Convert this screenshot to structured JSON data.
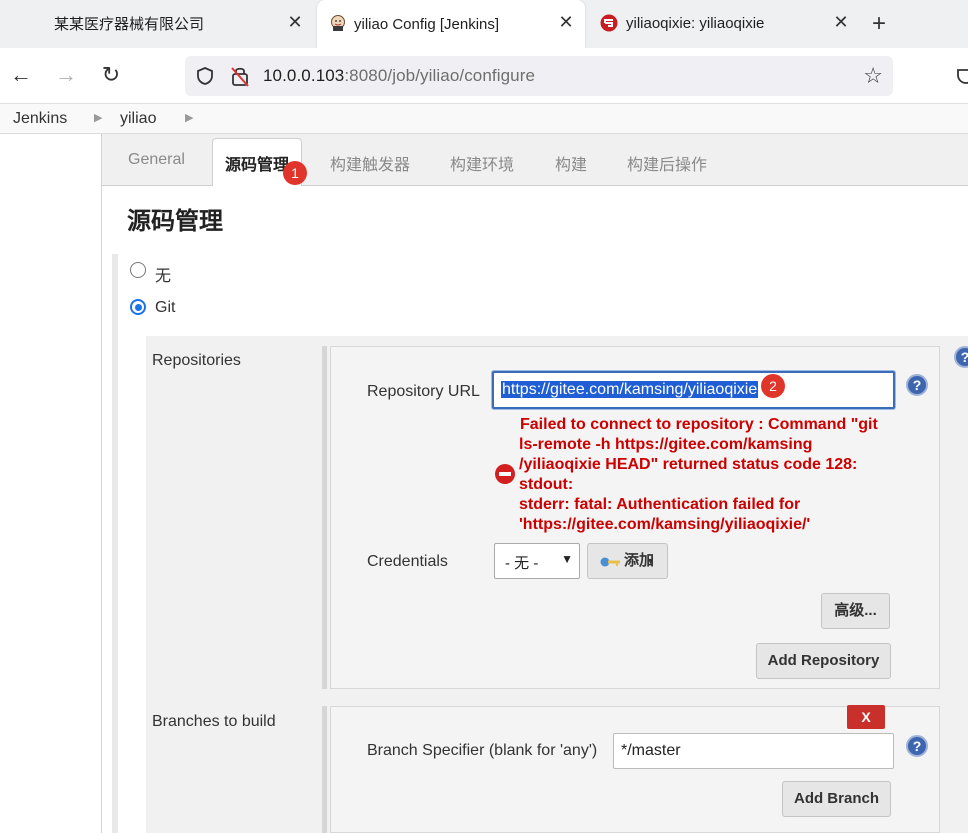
{
  "browser": {
    "tabs": [
      {
        "title": "某某医疗器械有限公司"
      },
      {
        "title": "yiliao Config [Jenkins]"
      },
      {
        "title": "yiliaoqixie: yiliaoqixie"
      }
    ],
    "url_host": "10.0.0.103",
    "url_rest": ":8080/job/yiliao/configure"
  },
  "breadcrumbs": [
    "Jenkins",
    "yiliao"
  ],
  "config_tabs": [
    "General",
    "源码管理",
    "构建触发器",
    "构建环境",
    "构建",
    "构建后操作"
  ],
  "annotations": {
    "badge1": "1",
    "badge2": "2"
  },
  "scm": {
    "title": "源码管理",
    "options": [
      {
        "label": "无",
        "checked": false
      },
      {
        "label": "Git",
        "checked": true
      }
    ]
  },
  "repositories": {
    "label": "Repositories",
    "url_label": "Repository URL",
    "url_value": "https://gitee.com/kamsing/yiliaoqixie",
    "error_lines": [
      "Failed to connect to repository : Command \"git",
      "ls-remote -h https://gitee.com/kamsing",
      "/yiliaoqixie HEAD\" returned status code 128:",
      "stdout:",
      "stderr: fatal: Authentication failed for",
      "'https://gitee.com/kamsing/yiliaoqixie/'"
    ],
    "credentials_label": "Credentials",
    "credentials_value": "- 无 -",
    "add_label": "添加",
    "advanced_label": "高级...",
    "add_repository_label": "Add Repository"
  },
  "branches": {
    "label": "Branches to build",
    "remove_label": "X",
    "specifier_label": "Branch Specifier (blank for 'any')",
    "specifier_value": "*/master",
    "add_branch_label": "Add Branch"
  },
  "colors": {
    "error": "#cc0000",
    "selection": "#1f5ed4",
    "badge": "#e0352b",
    "help": "#3e66b0"
  }
}
